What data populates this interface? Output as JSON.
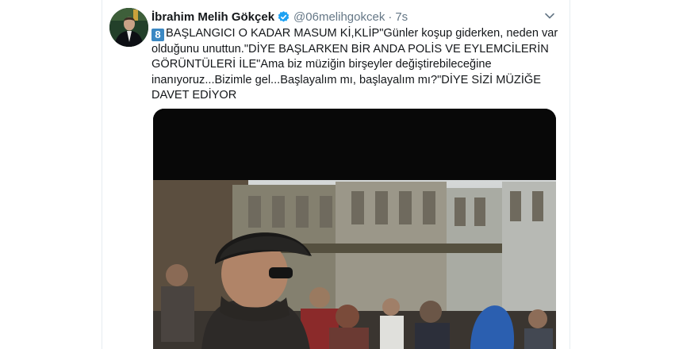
{
  "tweet": {
    "author_name": "İbrahim Melih Gökçek",
    "handle": "@06melihgokcek",
    "separator": "·",
    "time": "7s",
    "badge_number": "8",
    "text": "BAŞLANGICI O KADAR MASUM Kİ,KLİP\"Günler koşup giderken, neden var olduğunu unuttun.\"DİYE BAŞLARKEN BİR ANDA POLİS VE EYLEMCİLERİN GÖRÜNTÜLERİ İLE\"Ama biz müziğin birşeyler değiştirebileceğine inanıyoruz...Bizimle gel...Başlayalım mı, başlayalım mı?\"DİYE SİZİ MÜZİĞE DAVET EDİYOR"
  },
  "icons": {
    "verified": "verified-badge-icon",
    "caret": "chevron-down-icon",
    "keycap": "keycap-eight-emoji"
  },
  "colors": {
    "text": "#14171a",
    "secondary": "#657786",
    "verified": "#1da1f2",
    "keycap": "#3b88c3",
    "border": "#e6ecf0"
  }
}
